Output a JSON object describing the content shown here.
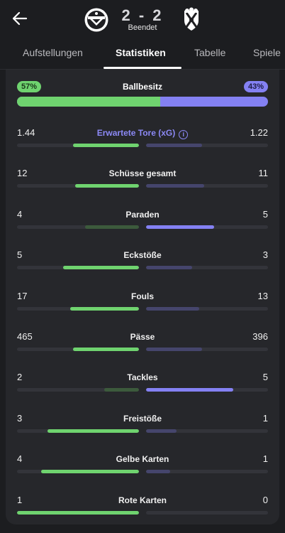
{
  "match": {
    "score": "2 - 2",
    "status": "Beendet"
  },
  "tabs": [
    {
      "label": "Aufstellungen",
      "active": false
    },
    {
      "label": "Statistiken",
      "active": true
    },
    {
      "label": "Tabelle",
      "active": false
    },
    {
      "label": "Spiele",
      "active": false
    }
  ],
  "possession": {
    "label": "Ballbesitz",
    "home_percent_label": "57%",
    "away_percent_label": "43%",
    "home_value": 57,
    "away_value": 43
  },
  "colors": {
    "home": "#6fd36f",
    "home_dim": "#3c5a3c",
    "away": "#8481f3",
    "away_dim": "#45456c",
    "link": "#8c89f6"
  },
  "stats": [
    {
      "label": "Erwartete Tore (xG)",
      "home": "1.44",
      "away": "1.22",
      "home_value": 1.44,
      "away_value": 1.22,
      "link": true
    },
    {
      "label": "Schüsse gesamt",
      "home": "12",
      "away": "11",
      "home_value": 12,
      "away_value": 11
    },
    {
      "label": "Paraden",
      "home": "4",
      "away": "5",
      "home_value": 4,
      "away_value": 5
    },
    {
      "label": "Eckstöße",
      "home": "5",
      "away": "3",
      "home_value": 5,
      "away_value": 3
    },
    {
      "label": "Fouls",
      "home": "17",
      "away": "13",
      "home_value": 17,
      "away_value": 13
    },
    {
      "label": "Pässe",
      "home": "465",
      "away": "396",
      "home_value": 465,
      "away_value": 396
    },
    {
      "label": "Tackles",
      "home": "2",
      "away": "5",
      "home_value": 2,
      "away_value": 5
    },
    {
      "label": "Freistöße",
      "home": "3",
      "away": "1",
      "home_value": 3,
      "away_value": 1
    },
    {
      "label": "Gelbe Karten",
      "home": "4",
      "away": "1",
      "home_value": 4,
      "away_value": 1
    },
    {
      "label": "Rote Karten",
      "home": "1",
      "away": "0",
      "home_value": 1,
      "away_value": 0
    }
  ]
}
